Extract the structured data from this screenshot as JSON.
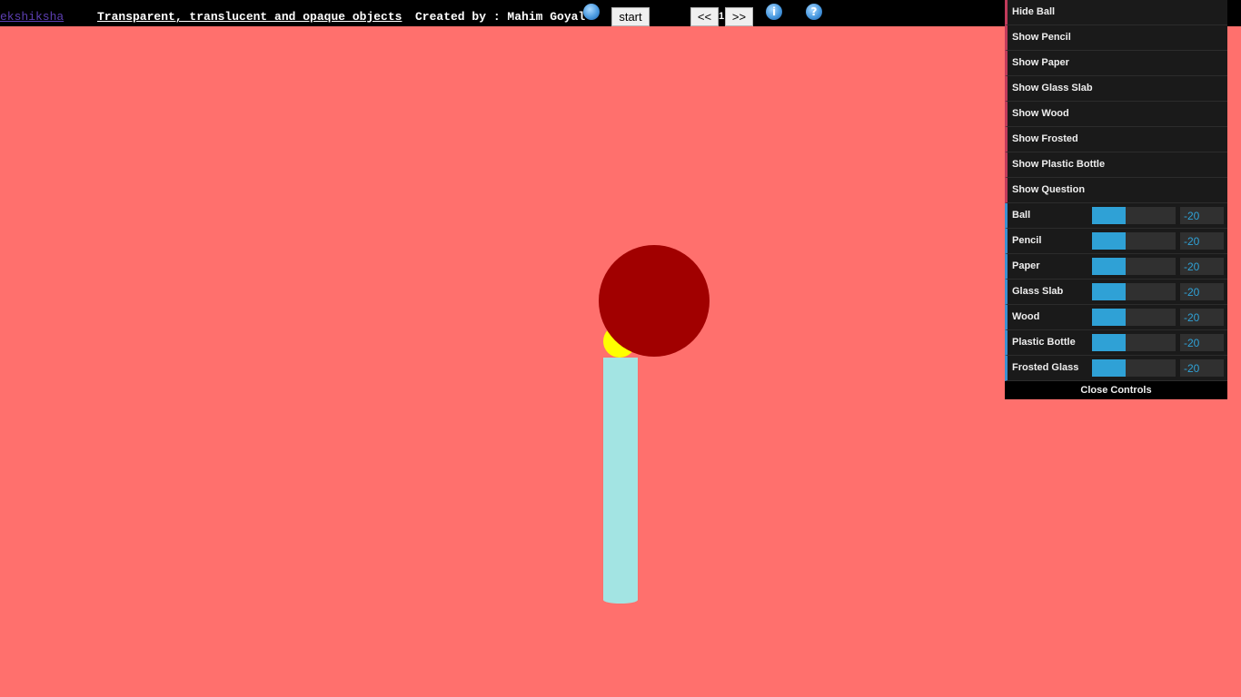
{
  "header": {
    "brand_link": "ekshiksha",
    "title": "Transparent, translucent and opaque objects",
    "credit": "Created by : Mahim Goyal",
    "start_label": "start",
    "prev_label": "<<",
    "page_number": "1",
    "next_label": ">>",
    "info_icon": "i",
    "help_icon": "?"
  },
  "controls": {
    "toggles": [
      {
        "label": "Hide Ball"
      },
      {
        "label": "Show Pencil"
      },
      {
        "label": "Show Paper"
      },
      {
        "label": "Show Glass Slab"
      },
      {
        "label": "Show Wood"
      },
      {
        "label": "Show Frosted"
      },
      {
        "label": "Show Plastic Bottle"
      },
      {
        "label": "Show Question"
      }
    ],
    "sliders": [
      {
        "label": "Ball",
        "value": "-20",
        "fill_fraction": 0.4
      },
      {
        "label": "Pencil",
        "value": "-20",
        "fill_fraction": 0.4
      },
      {
        "label": "Paper",
        "value": "-20",
        "fill_fraction": 0.4
      },
      {
        "label": "Glass Slab",
        "value": "-20",
        "fill_fraction": 0.4
      },
      {
        "label": "Wood",
        "value": "-20",
        "fill_fraction": 0.4
      },
      {
        "label": "Plastic Bottle",
        "value": "-20",
        "fill_fraction": 0.4
      },
      {
        "label": "Frosted Glass",
        "value": "-20",
        "fill_fraction": 0.4
      }
    ],
    "close_label": "Close Controls"
  },
  "colors": {
    "background": "#ff706d",
    "ball": "#a10000",
    "flame": "#ffff00",
    "candle": "#a3e4e3",
    "slider_accent": "#2fa1d6"
  }
}
